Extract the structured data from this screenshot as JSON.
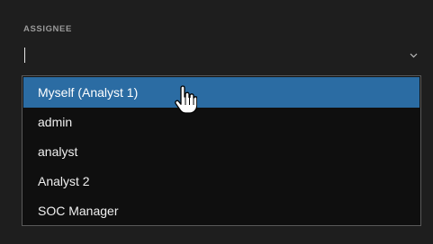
{
  "field": {
    "label": "ASSIGNEE",
    "value": ""
  },
  "dropdown": {
    "options": [
      {
        "label": "Myself (Analyst 1)",
        "highlighted": true
      },
      {
        "label": "admin",
        "highlighted": false
      },
      {
        "label": "analyst",
        "highlighted": false
      },
      {
        "label": "Analyst 2",
        "highlighted": false
      },
      {
        "label": "SOC Manager",
        "highlighted": false
      }
    ]
  },
  "icons": {
    "chevron": "chevron-down-icon",
    "pointer": "hand-pointer-cursor-icon"
  },
  "colors": {
    "background": "#1e1e1e",
    "dropdown_background": "#0f0f0f",
    "highlight": "#2b6ca3",
    "label": "#9a9a9a",
    "text": "#f0f0f0"
  }
}
